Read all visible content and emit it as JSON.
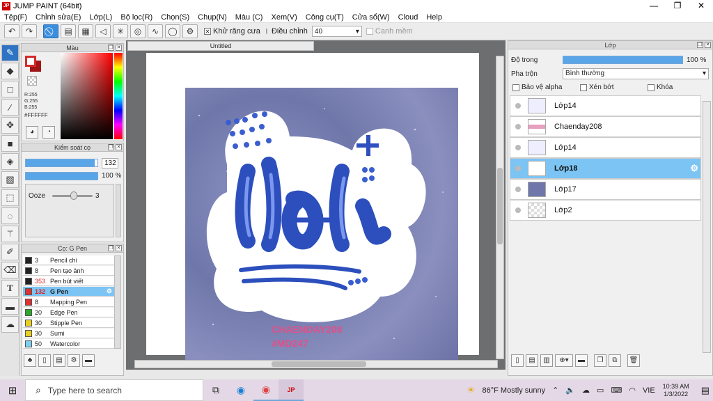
{
  "window": {
    "title": "JUMP PAINT (64bit)",
    "minimize": "—",
    "maximize": "❐",
    "close": "✕"
  },
  "menu": [
    "Tệp(F)",
    "Chỉnh sửa(E)",
    "Lớp(L)",
    "Bộ lọc(R)",
    "Chọn(S)",
    "Chụp(N)",
    "Màu (C)",
    "Xem(V)",
    "Công cụ(T)",
    "Cửa sổ(W)",
    "Cloud",
    "Help"
  ],
  "toolbar": {
    "antialias": "Khử răng cưa",
    "adjust": "Điều chỉnh",
    "adjust_value": "40",
    "smooth": "Canh mềm"
  },
  "color_panel": {
    "title": "Màu",
    "r": "R:255",
    "g": "G:255",
    "b": "B:255",
    "hex": "#FFFFFF",
    "fg": "#d62a2a",
    "bg": "#a01515"
  },
  "brush_control": {
    "title": "Kiểm soát cọ",
    "size": "132",
    "size_fill": 0.96,
    "opacity": "100 %",
    "opacity_fill": 1.0,
    "ooze_label": "Ooze",
    "ooze_value": "3"
  },
  "brush_list": {
    "title": "Cọ: G Pen",
    "items": [
      {
        "size": "3",
        "name": "Pencil chì",
        "color": "#222222"
      },
      {
        "size": "8",
        "name": "Pen tạo ảnh",
        "color": "#222222"
      },
      {
        "size": "353",
        "name": "Pen bút viết",
        "color": "#222222",
        "red": true
      },
      {
        "size": "132",
        "name": "G Pen",
        "color": "#e03030",
        "red": true,
        "selected": true
      },
      {
        "size": "8",
        "name": "Mapping Pen",
        "color": "#e03030"
      },
      {
        "size": "20",
        "name": "Edge Pen",
        "color": "#2aa82a"
      },
      {
        "size": "30",
        "name": "Stipple Pen",
        "color": "#e8d020"
      },
      {
        "size": "30",
        "name": "Sumi",
        "color": "#e8d020"
      },
      {
        "size": "50",
        "name": "Watercolor",
        "color": "#7fd0f0"
      }
    ]
  },
  "canvas": {
    "tab": "Untitled",
    "watermark1": "CHAENDAY208",
    "watermark2": "#MD247"
  },
  "layers": {
    "title": "Lớp",
    "opacity_label": "Độ trong",
    "opacity_value": "100 %",
    "opacity_fill": 1.0,
    "blend_label": "Pha trộn",
    "blend_value": "Bình thường",
    "protect_alpha": "Bảo vệ alpha",
    "clip": "Xén bớt",
    "lock": "Khóa",
    "items": [
      {
        "name": "Lớp14"
      },
      {
        "name": "Chaenday208"
      },
      {
        "name": "Lớp14"
      },
      {
        "name": "Lớp18",
        "selected": true
      },
      {
        "name": "Lớp17"
      },
      {
        "name": "Lớp2"
      }
    ]
  },
  "taskbar": {
    "search": "Type here to search",
    "weather": "86°F  Mostly sunny",
    "lang": "VIE",
    "time": "10:39 AM",
    "date": "1/3/2022"
  }
}
